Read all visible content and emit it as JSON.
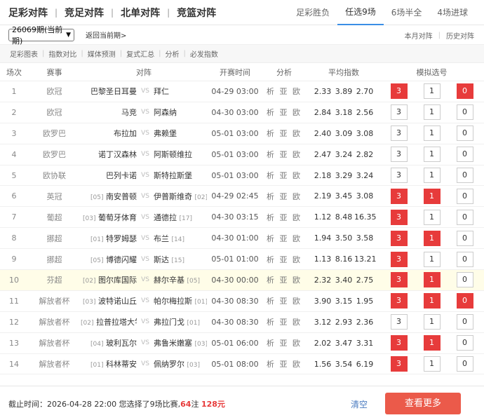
{
  "nav": [
    "足彩对阵",
    "竞足对阵",
    "北单对阵",
    "竞篮对阵"
  ],
  "tabs": [
    {
      "label": "足彩胜负",
      "active": false
    },
    {
      "label": "任选9场",
      "active": true
    },
    {
      "label": "6场半全",
      "active": false
    },
    {
      "label": "4场进球",
      "active": false
    }
  ],
  "period": {
    "value": "26069期(当前期)",
    "return_label": "返回当前期>"
  },
  "right_links": [
    "本月对阵",
    "历史对阵"
  ],
  "subnav": [
    "足彩图表",
    "指数对比",
    "媒体预测",
    "复式汇总",
    "分析",
    "必发指数"
  ],
  "columns": [
    "场次",
    "赛事",
    "对阵",
    "开赛时间",
    "分析",
    "平均指数",
    "模拟选号"
  ],
  "vs_label": "VS",
  "analysis_label": "析 亚 欧",
  "rows": [
    {
      "num": "1",
      "league": "欧冠",
      "home_rank": "",
      "home": "巴黎圣日耳曼",
      "away": "拜仁",
      "away_rank": "",
      "time": "04-29 03:00",
      "odds": [
        "2.33",
        "3.89",
        "2.70"
      ],
      "picks": [
        "3",
        "1",
        "0"
      ],
      "sel": [
        true,
        false,
        true
      ],
      "highlight": false
    },
    {
      "num": "2",
      "league": "欧冠",
      "home_rank": "",
      "home": "马竞",
      "away": "阿森纳",
      "away_rank": "",
      "time": "04-30 03:00",
      "odds": [
        "2.84",
        "3.18",
        "2.56"
      ],
      "picks": [
        "3",
        "1",
        "0"
      ],
      "sel": [
        false,
        false,
        false
      ],
      "highlight": false
    },
    {
      "num": "3",
      "league": "欧罗巴",
      "home_rank": "",
      "home": "布拉加",
      "away": "弗赖堡",
      "away_rank": "",
      "time": "05-01 03:00",
      "odds": [
        "2.40",
        "3.09",
        "3.08"
      ],
      "picks": [
        "3",
        "1",
        "0"
      ],
      "sel": [
        false,
        false,
        false
      ],
      "highlight": false
    },
    {
      "num": "4",
      "league": "欧罗巴",
      "home_rank": "",
      "home": "诺丁汉森林",
      "away": "阿斯顿维拉",
      "away_rank": "",
      "time": "05-01 03:00",
      "odds": [
        "2.47",
        "3.24",
        "2.82"
      ],
      "picks": [
        "3",
        "1",
        "0"
      ],
      "sel": [
        false,
        false,
        false
      ],
      "highlight": false
    },
    {
      "num": "5",
      "league": "欧协联",
      "home_rank": "",
      "home": "巴列卡诺",
      "away": "斯特拉斯堡",
      "away_rank": "",
      "time": "05-01 03:00",
      "odds": [
        "2.18",
        "3.29",
        "3.24"
      ],
      "picks": [
        "3",
        "1",
        "0"
      ],
      "sel": [
        false,
        false,
        false
      ],
      "highlight": false
    },
    {
      "num": "6",
      "league": "英冠",
      "home_rank": "[05]",
      "home": "南安普顿",
      "away": "伊普斯维奇",
      "away_rank": "[02]",
      "time": "04-29 02:45",
      "odds": [
        "2.19",
        "3.45",
        "3.08"
      ],
      "picks": [
        "3",
        "1",
        "0"
      ],
      "sel": [
        true,
        true,
        false
      ],
      "highlight": false
    },
    {
      "num": "7",
      "league": "葡超",
      "home_rank": "[03]",
      "home": "葡萄牙体育",
      "away": "通德拉",
      "away_rank": "[17]",
      "time": "04-30 03:15",
      "odds": [
        "1.12",
        "8.48",
        "16.35"
      ],
      "picks": [
        "3",
        "1",
        "0"
      ],
      "sel": [
        true,
        false,
        false
      ],
      "highlight": false
    },
    {
      "num": "8",
      "league": "挪超",
      "home_rank": "[01]",
      "home": "特罗姆瑟",
      "away": "布兰",
      "away_rank": "[14]",
      "time": "04-30 01:00",
      "odds": [
        "1.94",
        "3.50",
        "3.58"
      ],
      "picks": [
        "3",
        "1",
        "0"
      ],
      "sel": [
        true,
        true,
        false
      ],
      "highlight": false
    },
    {
      "num": "9",
      "league": "挪超",
      "home_rank": "[05]",
      "home": "博德闪耀",
      "away": "斯达",
      "away_rank": "[15]",
      "time": "05-01 01:00",
      "odds": [
        "1.13",
        "8.16",
        "13.21"
      ],
      "picks": [
        "3",
        "1",
        "0"
      ],
      "sel": [
        true,
        false,
        false
      ],
      "highlight": false
    },
    {
      "num": "10",
      "league": "芬超",
      "home_rank": "[02]",
      "home": "图尔库国际",
      "away": "赫尔辛基",
      "away_rank": "[05]",
      "time": "04-30 00:00",
      "odds": [
        "2.32",
        "3.40",
        "2.75"
      ],
      "picks": [
        "3",
        "1",
        "0"
      ],
      "sel": [
        true,
        true,
        false
      ],
      "highlight": true
    },
    {
      "num": "11",
      "league": "解放者杯",
      "home_rank": "[03]",
      "home": "波特诺山丘",
      "away": "帕尔梅拉斯",
      "away_rank": "[01]",
      "time": "04-30 08:30",
      "odds": [
        "3.90",
        "3.15",
        "1.95"
      ],
      "picks": [
        "3",
        "1",
        "0"
      ],
      "sel": [
        true,
        true,
        true
      ],
      "highlight": false
    },
    {
      "num": "12",
      "league": "解放者杯",
      "home_rank": "[02]",
      "home": "拉普拉塔大学生",
      "away": "弗拉门戈",
      "away_rank": "[01]",
      "time": "04-30 08:30",
      "odds": [
        "3.12",
        "2.93",
        "2.36"
      ],
      "picks": [
        "3",
        "1",
        "0"
      ],
      "sel": [
        false,
        false,
        false
      ],
      "highlight": false
    },
    {
      "num": "13",
      "league": "解放者杯",
      "home_rank": "[04]",
      "home": "玻利瓦尔",
      "away": "弗鲁米嫩塞",
      "away_rank": "[03]",
      "time": "05-01 06:00",
      "odds": [
        "2.02",
        "3.47",
        "3.31"
      ],
      "picks": [
        "3",
        "1",
        "0"
      ],
      "sel": [
        true,
        true,
        false
      ],
      "highlight": false
    },
    {
      "num": "14",
      "league": "解放者杯",
      "home_rank": "[01]",
      "home": "科林蒂安",
      "away": "佩纳罗尔",
      "away_rank": "[03]",
      "time": "05-01 08:00",
      "odds": [
        "1.56",
        "3.54",
        "6.19"
      ],
      "picks": [
        "3",
        "1",
        "0"
      ],
      "sel": [
        true,
        false,
        false
      ],
      "highlight": false
    }
  ],
  "footer": {
    "prefix": "截止时间：2026-04-28 22:00 您选择了9场比赛,",
    "count": "64",
    "unit": "注",
    "amount": "128元",
    "clear": "清空",
    "more": "查看更多"
  }
}
